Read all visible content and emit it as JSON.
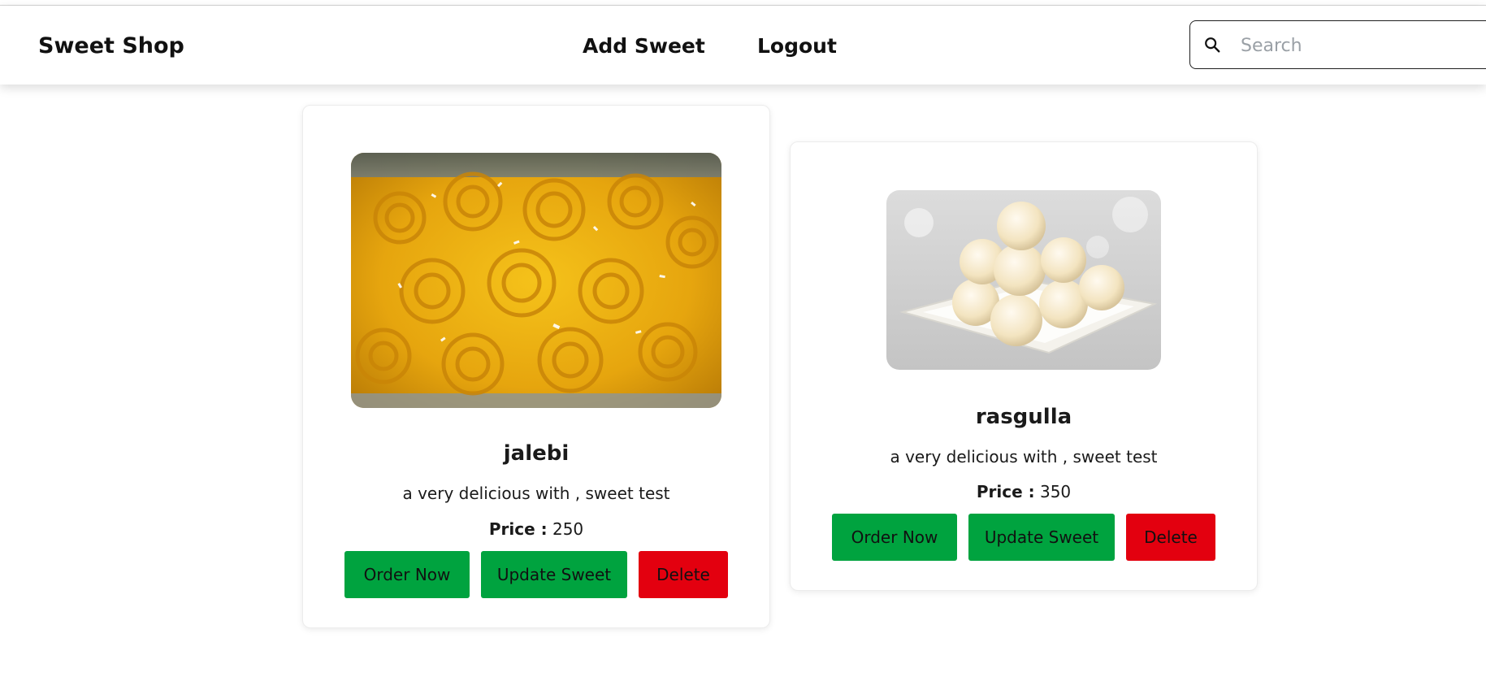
{
  "header": {
    "brand": "Sweet Shop",
    "nav": {
      "add_sweet": "Add Sweet",
      "logout": "Logout"
    },
    "search": {
      "placeholder": "Search",
      "value": "",
      "icon": "search-icon"
    }
  },
  "products": [
    {
      "name": "jalebi",
      "description": "a very delicious with , sweet test",
      "price_label": "Price :",
      "price": "250",
      "buttons": {
        "order": "Order Now",
        "update": "Update Sweet",
        "delete": "Delete"
      }
    },
    {
      "name": "rasgulla",
      "description": "a very delicious with , sweet test",
      "price_label": "Price :",
      "price": "350",
      "buttons": {
        "order": "Order Now",
        "update": "Update Sweet",
        "delete": "Delete"
      }
    }
  ],
  "colors": {
    "primary_button": "#00a33f",
    "danger_button": "#e3000f"
  }
}
